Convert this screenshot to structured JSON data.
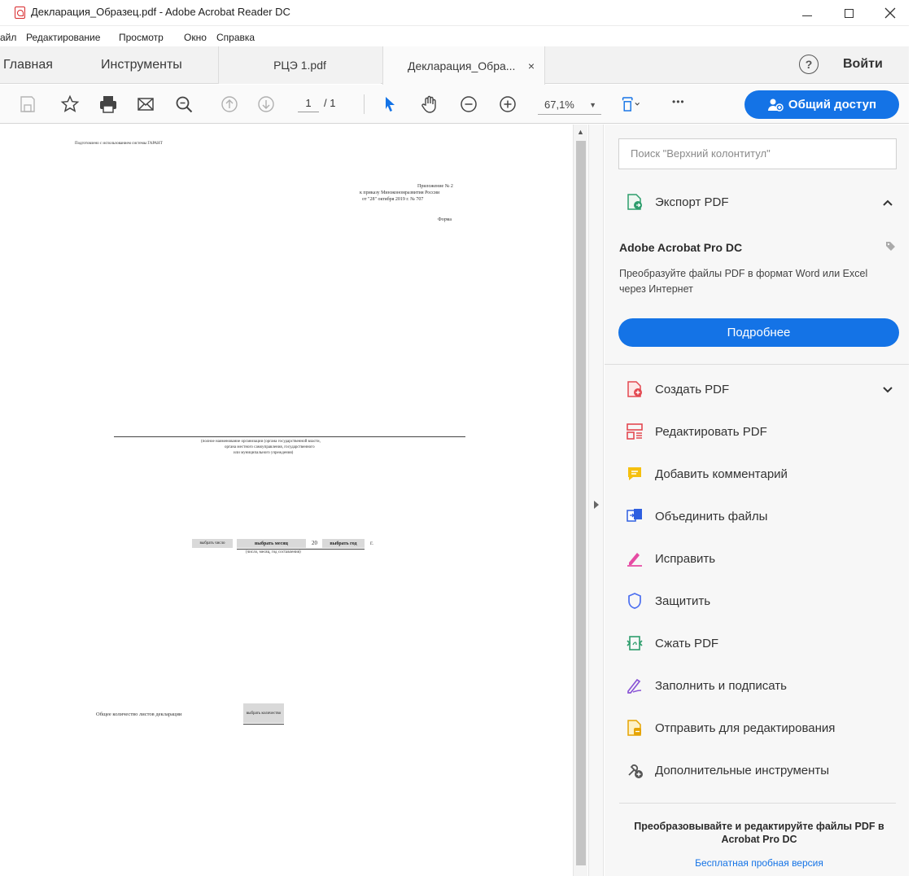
{
  "window": {
    "title": "Декларация_Образец.pdf - Adobe Acrobat Reader DC"
  },
  "menu": [
    "айл",
    "Редактирование",
    "Просмотр",
    "Окно",
    "Справка"
  ],
  "tabs": {
    "home": "Главная",
    "tools": "Инструменты",
    "doc1": "РЦЭ 1.pdf",
    "doc2": "Декларация_Обра...",
    "close_glyph": "×",
    "help": "?",
    "signin": "Войти"
  },
  "toolbar": {
    "page_current": "1",
    "page_total": "/ 1",
    "zoom": "67,1%",
    "more": "•••",
    "share_label": "Общий доступ"
  },
  "document": {
    "header_note": "Подготовлено с использованием системы ГАРАНТ",
    "appendix_line1": "Приложение № 2",
    "appendix_line2": "к приказу Минэкономразвития России",
    "appendix_line3": "от \"28\" октября 2019 г. № 707",
    "form_label": "Форма",
    "org_caption_line1": "(полное наименование организации (органа государственной власти,",
    "org_caption_line2": "органа местного самоуправления, государственного",
    "org_caption_line3": "или муниципального учреждения)",
    "field_day": "выбрать число",
    "field_month": "выбрать месяц",
    "year_prefix": "20",
    "field_year": "выбрать год",
    "year_suffix": "г.",
    "date_caption": "(число, месяц, год составления)",
    "sheets_label": "Общее количество листов декларации",
    "field_sheets": "выбрать количество"
  },
  "panel": {
    "search_placeholder": "Поиск \"Верхний колонтитул\"",
    "export_label": "Экспорт PDF",
    "pro_title": "Adobe Acrobat Pro DC",
    "pro_desc": "Преобразуйте файлы PDF в формат Word или Excel через Интернет",
    "more_button": "Подробнее",
    "tools": [
      {
        "label": "Создать PDF",
        "icon": "create-pdf-icon"
      },
      {
        "label": "Редактировать PDF",
        "icon": "edit-pdf-icon"
      },
      {
        "label": "Добавить комментарий",
        "icon": "comment-icon"
      },
      {
        "label": "Объединить файлы",
        "icon": "combine-files-icon"
      },
      {
        "label": "Исправить",
        "icon": "redact-icon"
      },
      {
        "label": "Защитить",
        "icon": "protect-icon"
      },
      {
        "label": "Сжать PDF",
        "icon": "compress-pdf-icon"
      },
      {
        "label": "Заполнить и подписать",
        "icon": "fill-sign-icon"
      },
      {
        "label": "Отправить для редактирования",
        "icon": "send-for-review-icon"
      },
      {
        "label": "Дополнительные инструменты",
        "icon": "more-tools-icon"
      }
    ],
    "promo_title": "Преобразовывайте и редактируйте файлы PDF в Acrobat Pro DC",
    "promo_link": "Бесплатная пробная версия"
  },
  "colors": {
    "accent": "#1473e6",
    "acrobat_red": "#d8272a"
  }
}
